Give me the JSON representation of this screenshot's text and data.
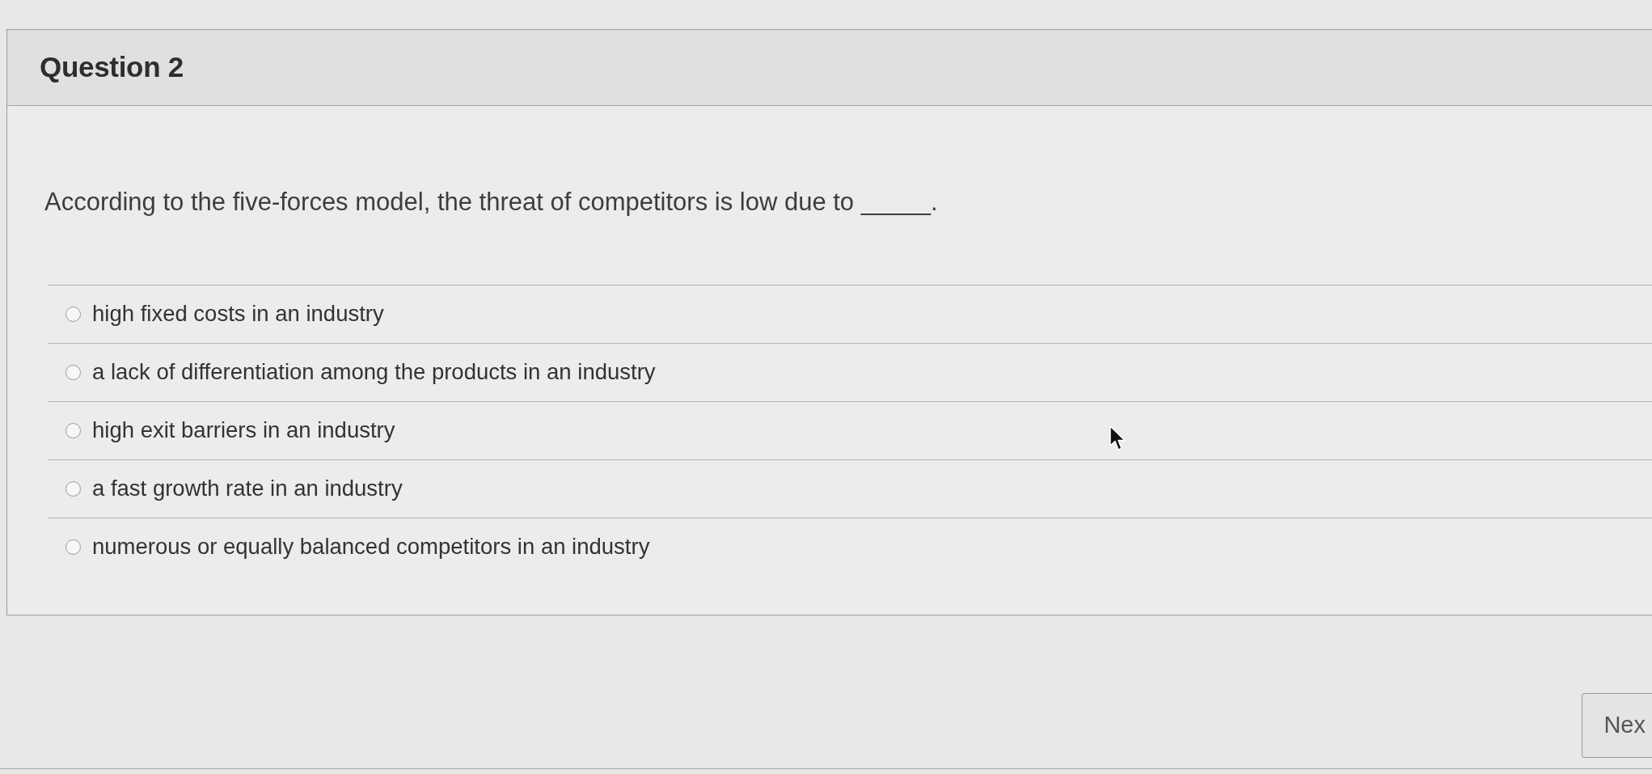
{
  "question": {
    "title": "Question 2",
    "text": "According to the five-forces model, the threat of competitors is low due to _____.",
    "options": [
      {
        "label": "high fixed costs in an industry",
        "selected": false
      },
      {
        "label": "a lack of differentiation among the products in an industry",
        "selected": false
      },
      {
        "label": "high exit barriers in an industry",
        "selected": false
      },
      {
        "label": "a fast growth rate in an industry",
        "selected": false
      },
      {
        "label": "numerous or equally balanced competitors in an industry",
        "selected": false
      }
    ]
  },
  "navigation": {
    "next_button": "Nex"
  }
}
